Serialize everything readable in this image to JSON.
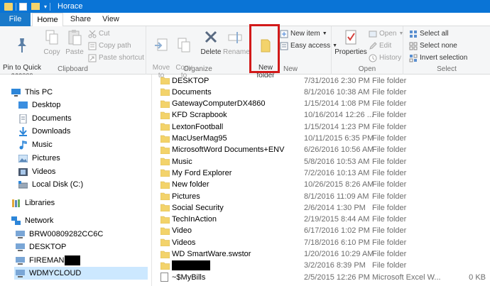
{
  "window": {
    "title": "Horace",
    "accent": "#0a74d6",
    "file_tab_color": "#1979ca",
    "highlight_color": "#d21a1a"
  },
  "tabs": [
    {
      "label": "File"
    },
    {
      "label": "Home"
    },
    {
      "label": "Share"
    },
    {
      "label": "View"
    }
  ],
  "ribbon": {
    "clipboard": {
      "label": "Clipboard",
      "pin": "Pin to Quick\naccess",
      "copy": "Copy",
      "paste": "Paste",
      "cut": "Cut",
      "copy_path": "Copy path",
      "paste_shortcut": "Paste shortcut"
    },
    "organize": {
      "label": "Organize",
      "move_to": "Move\nto",
      "copy_to": "Copy\nto",
      "delete": "Delete",
      "rename": "Rename"
    },
    "new": {
      "label": "New",
      "new_folder": "New\nfolder",
      "new_item": "New item",
      "easy_access": "Easy access"
    },
    "open": {
      "label": "Open",
      "properties": "Properties",
      "open": "Open",
      "edit": "Edit",
      "history": "History"
    },
    "select": {
      "label": "Select",
      "select_all": "Select all",
      "select_none": "Select none",
      "invert": "Invert selection"
    }
  },
  "nav": {
    "this_pc": "This PC",
    "desktop": "Desktop",
    "documents": "Documents",
    "downloads": "Downloads",
    "music": "Music",
    "pictures": "Pictures",
    "videos": "Videos",
    "local_disk": "Local Disk (C:)",
    "libraries": "Libraries",
    "network": "Network",
    "net1": "BRW00809282CC6C",
    "net2": "DESKTOP",
    "net3": "FIREMAN",
    "net4": "WDMYCLOUD"
  },
  "files": [
    {
      "name": "DESKTOP",
      "date": "7/31/2016 2:30 PM",
      "type": "File folder",
      "size": ""
    },
    {
      "name": "Documents",
      "date": "8/1/2016 10:38 AM",
      "type": "File folder",
      "size": ""
    },
    {
      "name": "GatewayComputerDX4860",
      "date": "1/15/2014 1:08 PM",
      "type": "File folder",
      "size": ""
    },
    {
      "name": "KFD Scrapbook",
      "date": "10/16/2014 12:26 ...",
      "type": "File folder",
      "size": ""
    },
    {
      "name": "LextonFootball",
      "date": "1/15/2014 1:23 PM",
      "type": "File folder",
      "size": ""
    },
    {
      "name": "MacUserMag95",
      "date": "10/11/2015 6:35 PM",
      "type": "File folder",
      "size": ""
    },
    {
      "name": "MicrosoftWord Documents+ENV",
      "date": "6/26/2016 10:56 AM",
      "type": "File folder",
      "size": ""
    },
    {
      "name": "Music",
      "date": "5/8/2016 10:53 AM",
      "type": "File folder",
      "size": ""
    },
    {
      "name": "My Ford Explorer",
      "date": "7/2/2016 10:13 AM",
      "type": "File folder",
      "size": ""
    },
    {
      "name": "New folder",
      "date": "10/26/2015 8:26 AM",
      "type": "File folder",
      "size": ""
    },
    {
      "name": "Pictures",
      "date": "8/1/2016 11:09 AM",
      "type": "File folder",
      "size": ""
    },
    {
      "name": "Social Security",
      "date": "2/6/2014 1:30 PM",
      "type": "File folder",
      "size": ""
    },
    {
      "name": "TechInAction",
      "date": "2/19/2015 8:44 AM",
      "type": "File folder",
      "size": ""
    },
    {
      "name": "Video",
      "date": "6/17/2016 1:02 PM",
      "type": "File folder",
      "size": ""
    },
    {
      "name": "Videos",
      "date": "7/18/2016 6:10 PM",
      "type": "File folder",
      "size": ""
    },
    {
      "name": "WD SmartWare.swstor",
      "date": "1/20/2016 10:29 AM",
      "type": "File folder",
      "size": ""
    },
    {
      "name": "",
      "date": "3/2/2016 8:39 PM",
      "type": "File folder",
      "size": ""
    },
    {
      "name": "~$MyBills",
      "date": "2/5/2015 12:26 PM",
      "type": "Microsoft Excel W...",
      "size": "0 KB"
    }
  ]
}
